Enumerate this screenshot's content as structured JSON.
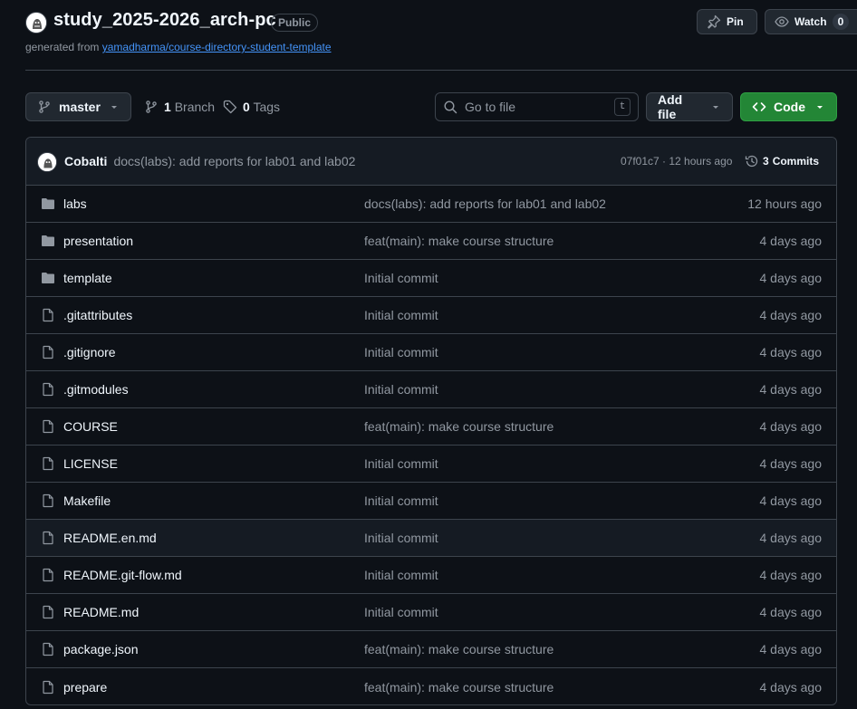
{
  "repo": {
    "name": "study_2025-2026_arch-pc",
    "visibility": "Public",
    "generated_prefix": "generated from",
    "template_link": "yamadharma/course-directory-student-template"
  },
  "header_actions": {
    "pin_label": "Pin",
    "watch_label": "Watch",
    "watch_count": "0"
  },
  "toolbar": {
    "branch": "master",
    "branch_count": "1",
    "branch_word": "Branch",
    "tag_count": "0",
    "tag_word": "Tags",
    "search_placeholder": "Go to file",
    "search_shortcut": "t",
    "add_file_label": "Add file",
    "code_label": "Code"
  },
  "latest_commit": {
    "author": "Cobalti",
    "message": "docs(labs): add reports for lab01 and lab02",
    "hash_time": "07f01c7 · 12 hours ago",
    "commits_count": "3",
    "commits_word": "Commits"
  },
  "files": [
    {
      "name": "labs",
      "type": "folder",
      "message": "docs(labs): add reports for lab01 and lab02",
      "date": "12 hours ago"
    },
    {
      "name": "presentation",
      "type": "folder",
      "message": "feat(main): make course structure",
      "date": "4 days ago"
    },
    {
      "name": "template",
      "type": "folder",
      "message": "Initial commit",
      "date": "4 days ago"
    },
    {
      "name": ".gitattributes",
      "type": "file",
      "message": "Initial commit",
      "date": "4 days ago"
    },
    {
      "name": ".gitignore",
      "type": "file",
      "message": "Initial commit",
      "date": "4 days ago"
    },
    {
      "name": ".gitmodules",
      "type": "file",
      "message": "Initial commit",
      "date": "4 days ago"
    },
    {
      "name": "COURSE",
      "type": "file",
      "message": "feat(main): make course structure",
      "date": "4 days ago"
    },
    {
      "name": "LICENSE",
      "type": "file",
      "message": "Initial commit",
      "date": "4 days ago"
    },
    {
      "name": "Makefile",
      "type": "file",
      "message": "Initial commit",
      "date": "4 days ago"
    },
    {
      "name": "README.en.md",
      "type": "file",
      "message": "Initial commit",
      "date": "4 days ago"
    },
    {
      "name": "README.git-flow.md",
      "type": "file",
      "message": "Initial commit",
      "date": "4 days ago"
    },
    {
      "name": "README.md",
      "type": "file",
      "message": "Initial commit",
      "date": "4 days ago"
    },
    {
      "name": "package.json",
      "type": "file",
      "message": "feat(main): make course structure",
      "date": "4 days ago"
    },
    {
      "name": "prepare",
      "type": "file",
      "message": "feat(main): make course structure",
      "date": "4 days ago"
    }
  ]
}
